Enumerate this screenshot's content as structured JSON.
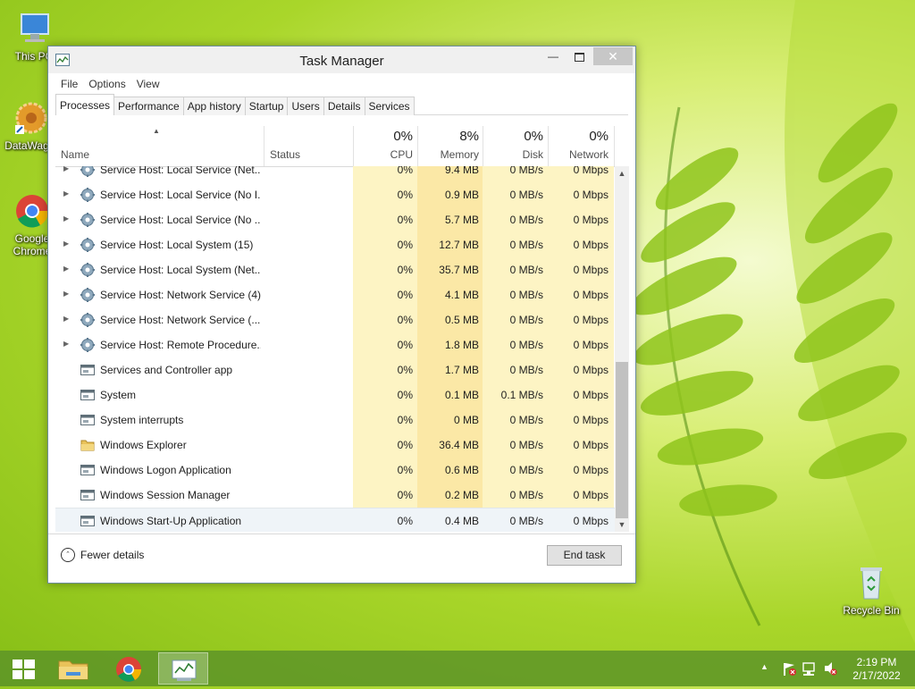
{
  "desktop": {
    "icons": [
      {
        "label": "This PC"
      },
      {
        "label": "DataWag..."
      },
      {
        "label": "Google Chrome"
      },
      {
        "label": "Recycle Bin"
      }
    ]
  },
  "window": {
    "title": "Task Manager",
    "menu": [
      "File",
      "Options",
      "View"
    ],
    "tabs": [
      "Processes",
      "Performance",
      "App history",
      "Startup",
      "Users",
      "Details",
      "Services"
    ],
    "active_tab": "Processes"
  },
  "columns": {
    "name": "Name",
    "status": "Status",
    "cpu": {
      "pct": "0%",
      "label": "CPU"
    },
    "memory": {
      "pct": "8%",
      "label": "Memory"
    },
    "disk": {
      "pct": "0%",
      "label": "Disk"
    },
    "network": {
      "pct": "0%",
      "label": "Network"
    }
  },
  "rows": [
    {
      "name": "Service Host: Local Service (Net...",
      "cpu": "0%",
      "mem": "9.4 MB",
      "disk": "0 MB/s",
      "net": "0 Mbps",
      "icon": "gear-icon",
      "expandable": true
    },
    {
      "name": "Service Host: Local Service (No I...",
      "cpu": "0%",
      "mem": "0.9 MB",
      "disk": "0 MB/s",
      "net": "0 Mbps",
      "icon": "gear-icon",
      "expandable": true
    },
    {
      "name": "Service Host: Local Service (No ...",
      "cpu": "0%",
      "mem": "5.7 MB",
      "disk": "0 MB/s",
      "net": "0 Mbps",
      "icon": "gear-icon",
      "expandable": true
    },
    {
      "name": "Service Host: Local System (15)",
      "cpu": "0%",
      "mem": "12.7 MB",
      "disk": "0 MB/s",
      "net": "0 Mbps",
      "icon": "gear-icon",
      "expandable": true
    },
    {
      "name": "Service Host: Local System (Net...",
      "cpu": "0%",
      "mem": "35.7 MB",
      "disk": "0 MB/s",
      "net": "0 Mbps",
      "icon": "gear-icon",
      "expandable": true
    },
    {
      "name": "Service Host: Network Service (4)",
      "cpu": "0%",
      "mem": "4.1 MB",
      "disk": "0 MB/s",
      "net": "0 Mbps",
      "icon": "gear-icon",
      "expandable": true
    },
    {
      "name": "Service Host: Network Service (...",
      "cpu": "0%",
      "mem": "0.5 MB",
      "disk": "0 MB/s",
      "net": "0 Mbps",
      "icon": "gear-icon",
      "expandable": true
    },
    {
      "name": "Service Host: Remote Procedure...",
      "cpu": "0%",
      "mem": "1.8 MB",
      "disk": "0 MB/s",
      "net": "0 Mbps",
      "icon": "gear-icon",
      "expandable": true
    },
    {
      "name": "Services and Controller app",
      "cpu": "0%",
      "mem": "1.7 MB",
      "disk": "0 MB/s",
      "net": "0 Mbps",
      "icon": "window-app-icon",
      "expandable": false
    },
    {
      "name": "System",
      "cpu": "0%",
      "mem": "0.1 MB",
      "disk": "0.1 MB/s",
      "net": "0 Mbps",
      "icon": "window-app-icon",
      "expandable": false
    },
    {
      "name": "System interrupts",
      "cpu": "0%",
      "mem": "0 MB",
      "disk": "0 MB/s",
      "net": "0 Mbps",
      "icon": "window-app-icon",
      "expandable": false
    },
    {
      "name": "Windows Explorer",
      "cpu": "0%",
      "mem": "36.4 MB",
      "disk": "0 MB/s",
      "net": "0 Mbps",
      "icon": "folder-icon",
      "expandable": false
    },
    {
      "name": "Windows Logon Application",
      "cpu": "0%",
      "mem": "0.6 MB",
      "disk": "0 MB/s",
      "net": "0 Mbps",
      "icon": "window-app-icon",
      "expandable": false
    },
    {
      "name": "Windows Session Manager",
      "cpu": "0%",
      "mem": "0.2 MB",
      "disk": "0 MB/s",
      "net": "0 Mbps",
      "icon": "window-app-icon",
      "expandable": false
    },
    {
      "name": "Windows Start-Up Application",
      "cpu": "0%",
      "mem": "0.4 MB",
      "disk": "0 MB/s",
      "net": "0 Mbps",
      "icon": "window-app-icon",
      "expandable": false
    }
  ],
  "selected_row": 14,
  "footer": {
    "fewer_details": "Fewer details",
    "end_task": "End task"
  },
  "taskbar": {
    "clock_time": "2:19 PM",
    "clock_date": "2/17/2022"
  },
  "colors": {
    "cpu_heat": "#fdf4c4",
    "mem_heat": "#fbe8a6",
    "disk_heat": "#fdf4c4",
    "net_heat": "#fdf4c4",
    "zero_mem_heat": "#fdf4c4"
  }
}
